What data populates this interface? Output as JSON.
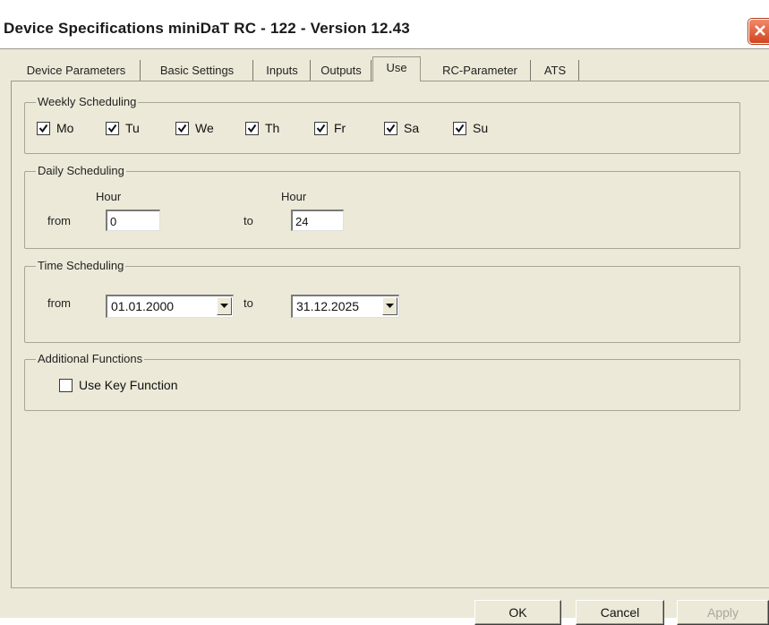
{
  "window": {
    "title": "Device Specifications miniDaT RC - 122 - Version 12.43"
  },
  "tabs": [
    {
      "label": "Device Parameters"
    },
    {
      "label": "Basic Settings"
    },
    {
      "label": "Inputs"
    },
    {
      "label": "Outputs"
    },
    {
      "label": "Use"
    },
    {
      "label": "RC-Parameter"
    },
    {
      "label": "ATS"
    }
  ],
  "active_tab": "Use",
  "weekly": {
    "legend": "Weekly Scheduling",
    "days": [
      {
        "label": "Mo",
        "checked": true
      },
      {
        "label": "Tu",
        "checked": true
      },
      {
        "label": "We",
        "checked": true
      },
      {
        "label": "Th",
        "checked": true
      },
      {
        "label": "Fr",
        "checked": true
      },
      {
        "label": "Sa",
        "checked": true
      },
      {
        "label": "Su",
        "checked": true
      }
    ]
  },
  "daily": {
    "legend": "Daily Scheduling",
    "hour_label_from": "Hour",
    "hour_label_to": "Hour",
    "from_label": "from",
    "to_label": "to",
    "from_value": "0",
    "to_value": "24"
  },
  "time": {
    "legend": "Time Scheduling",
    "from_label": "from",
    "to_label": "to",
    "from_value": "01.01.2000",
    "to_value": "31.12.2025"
  },
  "additional": {
    "legend": "Additional Functions",
    "use_key_label": "Use Key Function",
    "use_key_checked": false
  },
  "buttons": {
    "ok": "OK",
    "cancel": "Cancel",
    "apply": "Apply"
  },
  "colors": {
    "face": "#ece9d8",
    "close": "#d2441e"
  }
}
